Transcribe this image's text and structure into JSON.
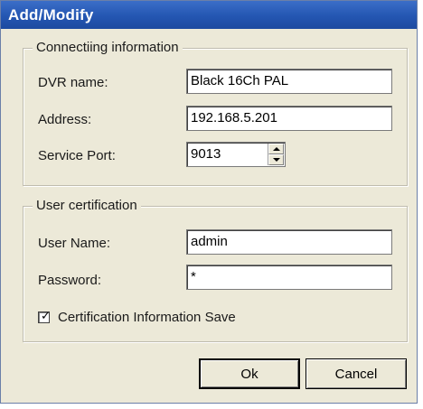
{
  "dialog": {
    "title": "Add/Modify",
    "connection": {
      "legend": "Connectiing information",
      "dvr_name_label": "DVR name:",
      "dvr_name_value": "Black 16Ch PAL",
      "address_label": "Address:",
      "address_value": "192.168.5.201",
      "port_label": "Service Port:",
      "port_value": "9013"
    },
    "user": {
      "legend": "User certification",
      "username_label": "User Name:",
      "username_value": "admin",
      "password_label": "Password:",
      "password_value": "*",
      "save_label": "Certification Information Save",
      "save_checked": true
    },
    "buttons": {
      "ok": "Ok",
      "cancel": "Cancel"
    }
  },
  "colors": {
    "titlebar": "#2456b2",
    "dialog_bg": "#ece9d8"
  },
  "icons": {
    "spinner_up": "triangle-up-icon",
    "spinner_down": "triangle-down-icon",
    "checkbox": "check-icon"
  }
}
